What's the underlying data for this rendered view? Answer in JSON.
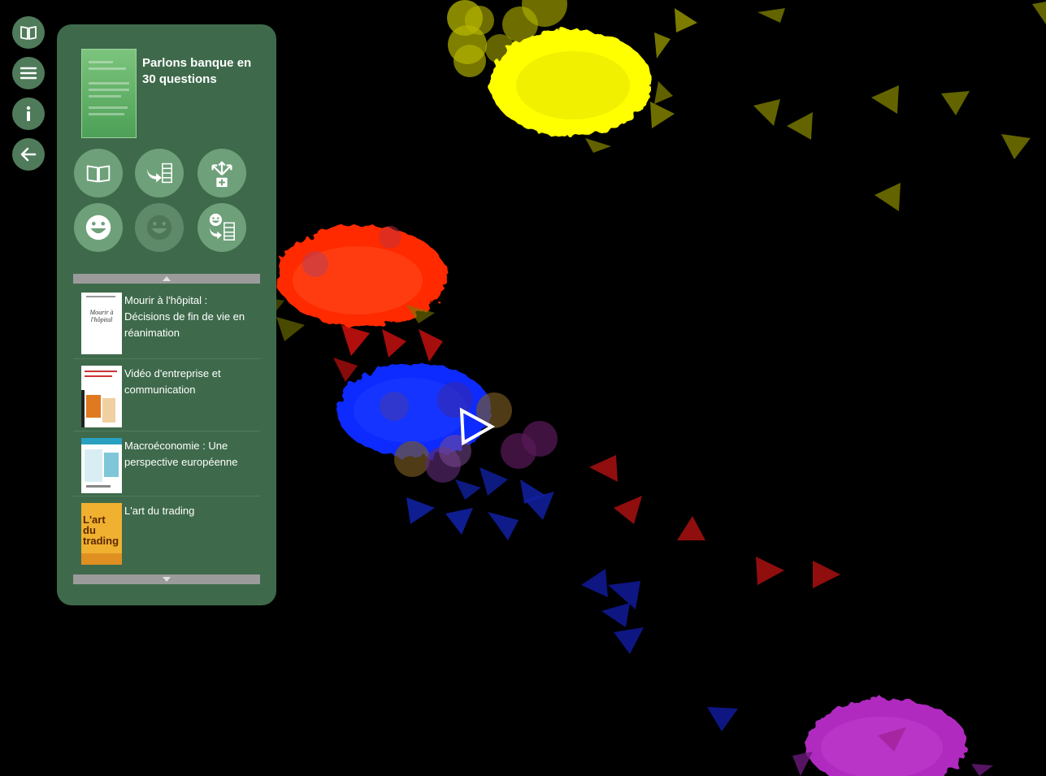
{
  "rail": {
    "buttons": [
      {
        "icon": "book-icon"
      },
      {
        "icon": "menu-icon"
      },
      {
        "icon": "info-icon"
      },
      {
        "icon": "back-arrow-icon"
      }
    ]
  },
  "current_book": {
    "title": "Parlons banque en 30 questions"
  },
  "actions": [
    {
      "icon": "open-book-icon"
    },
    {
      "icon": "add-to-list-icon"
    },
    {
      "icon": "expand-add-icon"
    },
    {
      "icon": "like-icon"
    },
    {
      "icon": "dislike-icon"
    },
    {
      "icon": "like-add-to-list-icon"
    }
  ],
  "list": {
    "items": [
      {
        "title": "Mourir à l'hôpital : Décisions de fin de vie en réanimation",
        "cover_text": "Mourir à l'hôpital"
      },
      {
        "title": "Vidéo d'entreprise et communication",
        "cover_text": ""
      },
      {
        "title": "Macroéconomie : Une perspective européenne",
        "cover_text": ""
      },
      {
        "title": "L'art du trading",
        "cover_text": "L'art du trading"
      }
    ]
  },
  "colors": {
    "panel": "#3e6a4b",
    "rail_button": "#4f7b5a",
    "cluster_yellow": "#ffff00",
    "cluster_red": "#ff2a00",
    "cluster_blue": "#0a2aff",
    "cluster_magenta": "#b02cc0"
  }
}
